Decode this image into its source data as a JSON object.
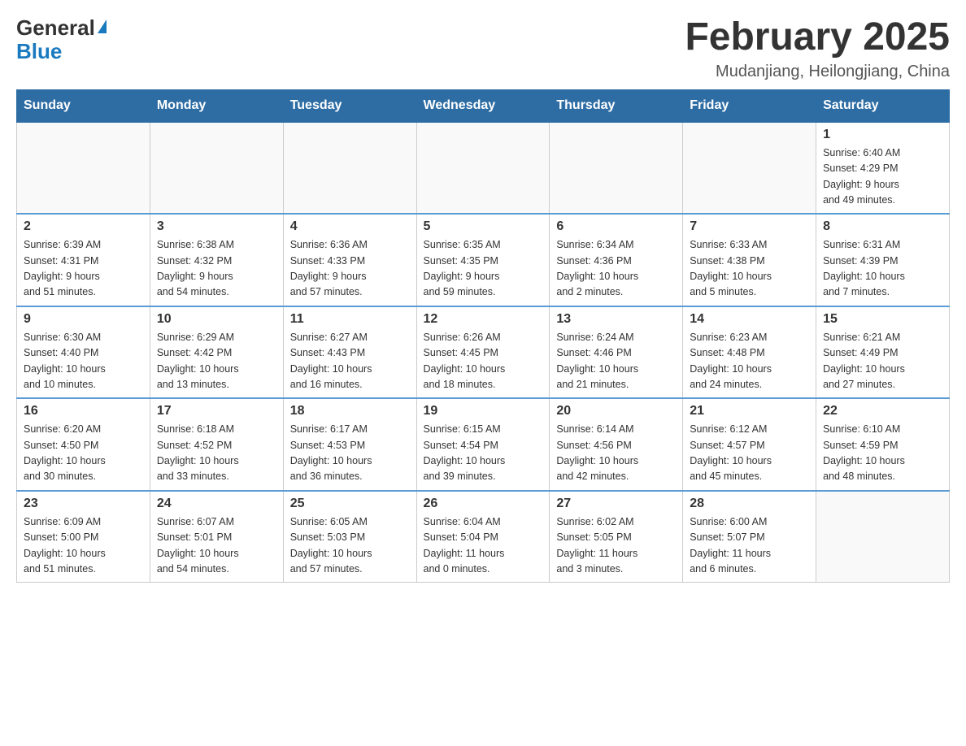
{
  "header": {
    "logo": {
      "general": "General",
      "blue": "Blue",
      "triangle_symbol": "▲"
    },
    "title": "February 2025",
    "location": "Mudanjiang, Heilongjiang, China"
  },
  "weekdays": [
    "Sunday",
    "Monday",
    "Tuesday",
    "Wednesday",
    "Thursday",
    "Friday",
    "Saturday"
  ],
  "weeks": [
    [
      {
        "day": "",
        "info": ""
      },
      {
        "day": "",
        "info": ""
      },
      {
        "day": "",
        "info": ""
      },
      {
        "day": "",
        "info": ""
      },
      {
        "day": "",
        "info": ""
      },
      {
        "day": "",
        "info": ""
      },
      {
        "day": "1",
        "info": "Sunrise: 6:40 AM\nSunset: 4:29 PM\nDaylight: 9 hours\nand 49 minutes."
      }
    ],
    [
      {
        "day": "2",
        "info": "Sunrise: 6:39 AM\nSunset: 4:31 PM\nDaylight: 9 hours\nand 51 minutes."
      },
      {
        "day": "3",
        "info": "Sunrise: 6:38 AM\nSunset: 4:32 PM\nDaylight: 9 hours\nand 54 minutes."
      },
      {
        "day": "4",
        "info": "Sunrise: 6:36 AM\nSunset: 4:33 PM\nDaylight: 9 hours\nand 57 minutes."
      },
      {
        "day": "5",
        "info": "Sunrise: 6:35 AM\nSunset: 4:35 PM\nDaylight: 9 hours\nand 59 minutes."
      },
      {
        "day": "6",
        "info": "Sunrise: 6:34 AM\nSunset: 4:36 PM\nDaylight: 10 hours\nand 2 minutes."
      },
      {
        "day": "7",
        "info": "Sunrise: 6:33 AM\nSunset: 4:38 PM\nDaylight: 10 hours\nand 5 minutes."
      },
      {
        "day": "8",
        "info": "Sunrise: 6:31 AM\nSunset: 4:39 PM\nDaylight: 10 hours\nand 7 minutes."
      }
    ],
    [
      {
        "day": "9",
        "info": "Sunrise: 6:30 AM\nSunset: 4:40 PM\nDaylight: 10 hours\nand 10 minutes."
      },
      {
        "day": "10",
        "info": "Sunrise: 6:29 AM\nSunset: 4:42 PM\nDaylight: 10 hours\nand 13 minutes."
      },
      {
        "day": "11",
        "info": "Sunrise: 6:27 AM\nSunset: 4:43 PM\nDaylight: 10 hours\nand 16 minutes."
      },
      {
        "day": "12",
        "info": "Sunrise: 6:26 AM\nSunset: 4:45 PM\nDaylight: 10 hours\nand 18 minutes."
      },
      {
        "day": "13",
        "info": "Sunrise: 6:24 AM\nSunset: 4:46 PM\nDaylight: 10 hours\nand 21 minutes."
      },
      {
        "day": "14",
        "info": "Sunrise: 6:23 AM\nSunset: 4:48 PM\nDaylight: 10 hours\nand 24 minutes."
      },
      {
        "day": "15",
        "info": "Sunrise: 6:21 AM\nSunset: 4:49 PM\nDaylight: 10 hours\nand 27 minutes."
      }
    ],
    [
      {
        "day": "16",
        "info": "Sunrise: 6:20 AM\nSunset: 4:50 PM\nDaylight: 10 hours\nand 30 minutes."
      },
      {
        "day": "17",
        "info": "Sunrise: 6:18 AM\nSunset: 4:52 PM\nDaylight: 10 hours\nand 33 minutes."
      },
      {
        "day": "18",
        "info": "Sunrise: 6:17 AM\nSunset: 4:53 PM\nDaylight: 10 hours\nand 36 minutes."
      },
      {
        "day": "19",
        "info": "Sunrise: 6:15 AM\nSunset: 4:54 PM\nDaylight: 10 hours\nand 39 minutes."
      },
      {
        "day": "20",
        "info": "Sunrise: 6:14 AM\nSunset: 4:56 PM\nDaylight: 10 hours\nand 42 minutes."
      },
      {
        "day": "21",
        "info": "Sunrise: 6:12 AM\nSunset: 4:57 PM\nDaylight: 10 hours\nand 45 minutes."
      },
      {
        "day": "22",
        "info": "Sunrise: 6:10 AM\nSunset: 4:59 PM\nDaylight: 10 hours\nand 48 minutes."
      }
    ],
    [
      {
        "day": "23",
        "info": "Sunrise: 6:09 AM\nSunset: 5:00 PM\nDaylight: 10 hours\nand 51 minutes."
      },
      {
        "day": "24",
        "info": "Sunrise: 6:07 AM\nSunset: 5:01 PM\nDaylight: 10 hours\nand 54 minutes."
      },
      {
        "day": "25",
        "info": "Sunrise: 6:05 AM\nSunset: 5:03 PM\nDaylight: 10 hours\nand 57 minutes."
      },
      {
        "day": "26",
        "info": "Sunrise: 6:04 AM\nSunset: 5:04 PM\nDaylight: 11 hours\nand 0 minutes."
      },
      {
        "day": "27",
        "info": "Sunrise: 6:02 AM\nSunset: 5:05 PM\nDaylight: 11 hours\nand 3 minutes."
      },
      {
        "day": "28",
        "info": "Sunrise: 6:00 AM\nSunset: 5:07 PM\nDaylight: 11 hours\nand 6 minutes."
      },
      {
        "day": "",
        "info": ""
      }
    ]
  ]
}
